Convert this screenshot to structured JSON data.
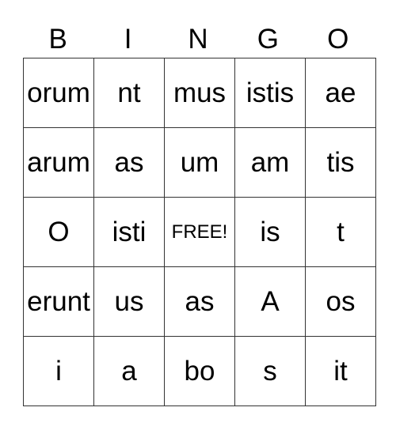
{
  "header": [
    "B",
    "I",
    "N",
    "G",
    "O"
  ],
  "rows": [
    [
      "orum",
      "nt",
      "mus",
      "istis",
      "ae"
    ],
    [
      "arum",
      "as",
      "um",
      "am",
      "tis"
    ],
    [
      "O",
      "isti",
      "FREE!",
      "is",
      "t"
    ],
    [
      "erunt",
      "us",
      "as",
      "A",
      "os"
    ],
    [
      "i",
      "a",
      "bo",
      "s",
      "it"
    ]
  ]
}
